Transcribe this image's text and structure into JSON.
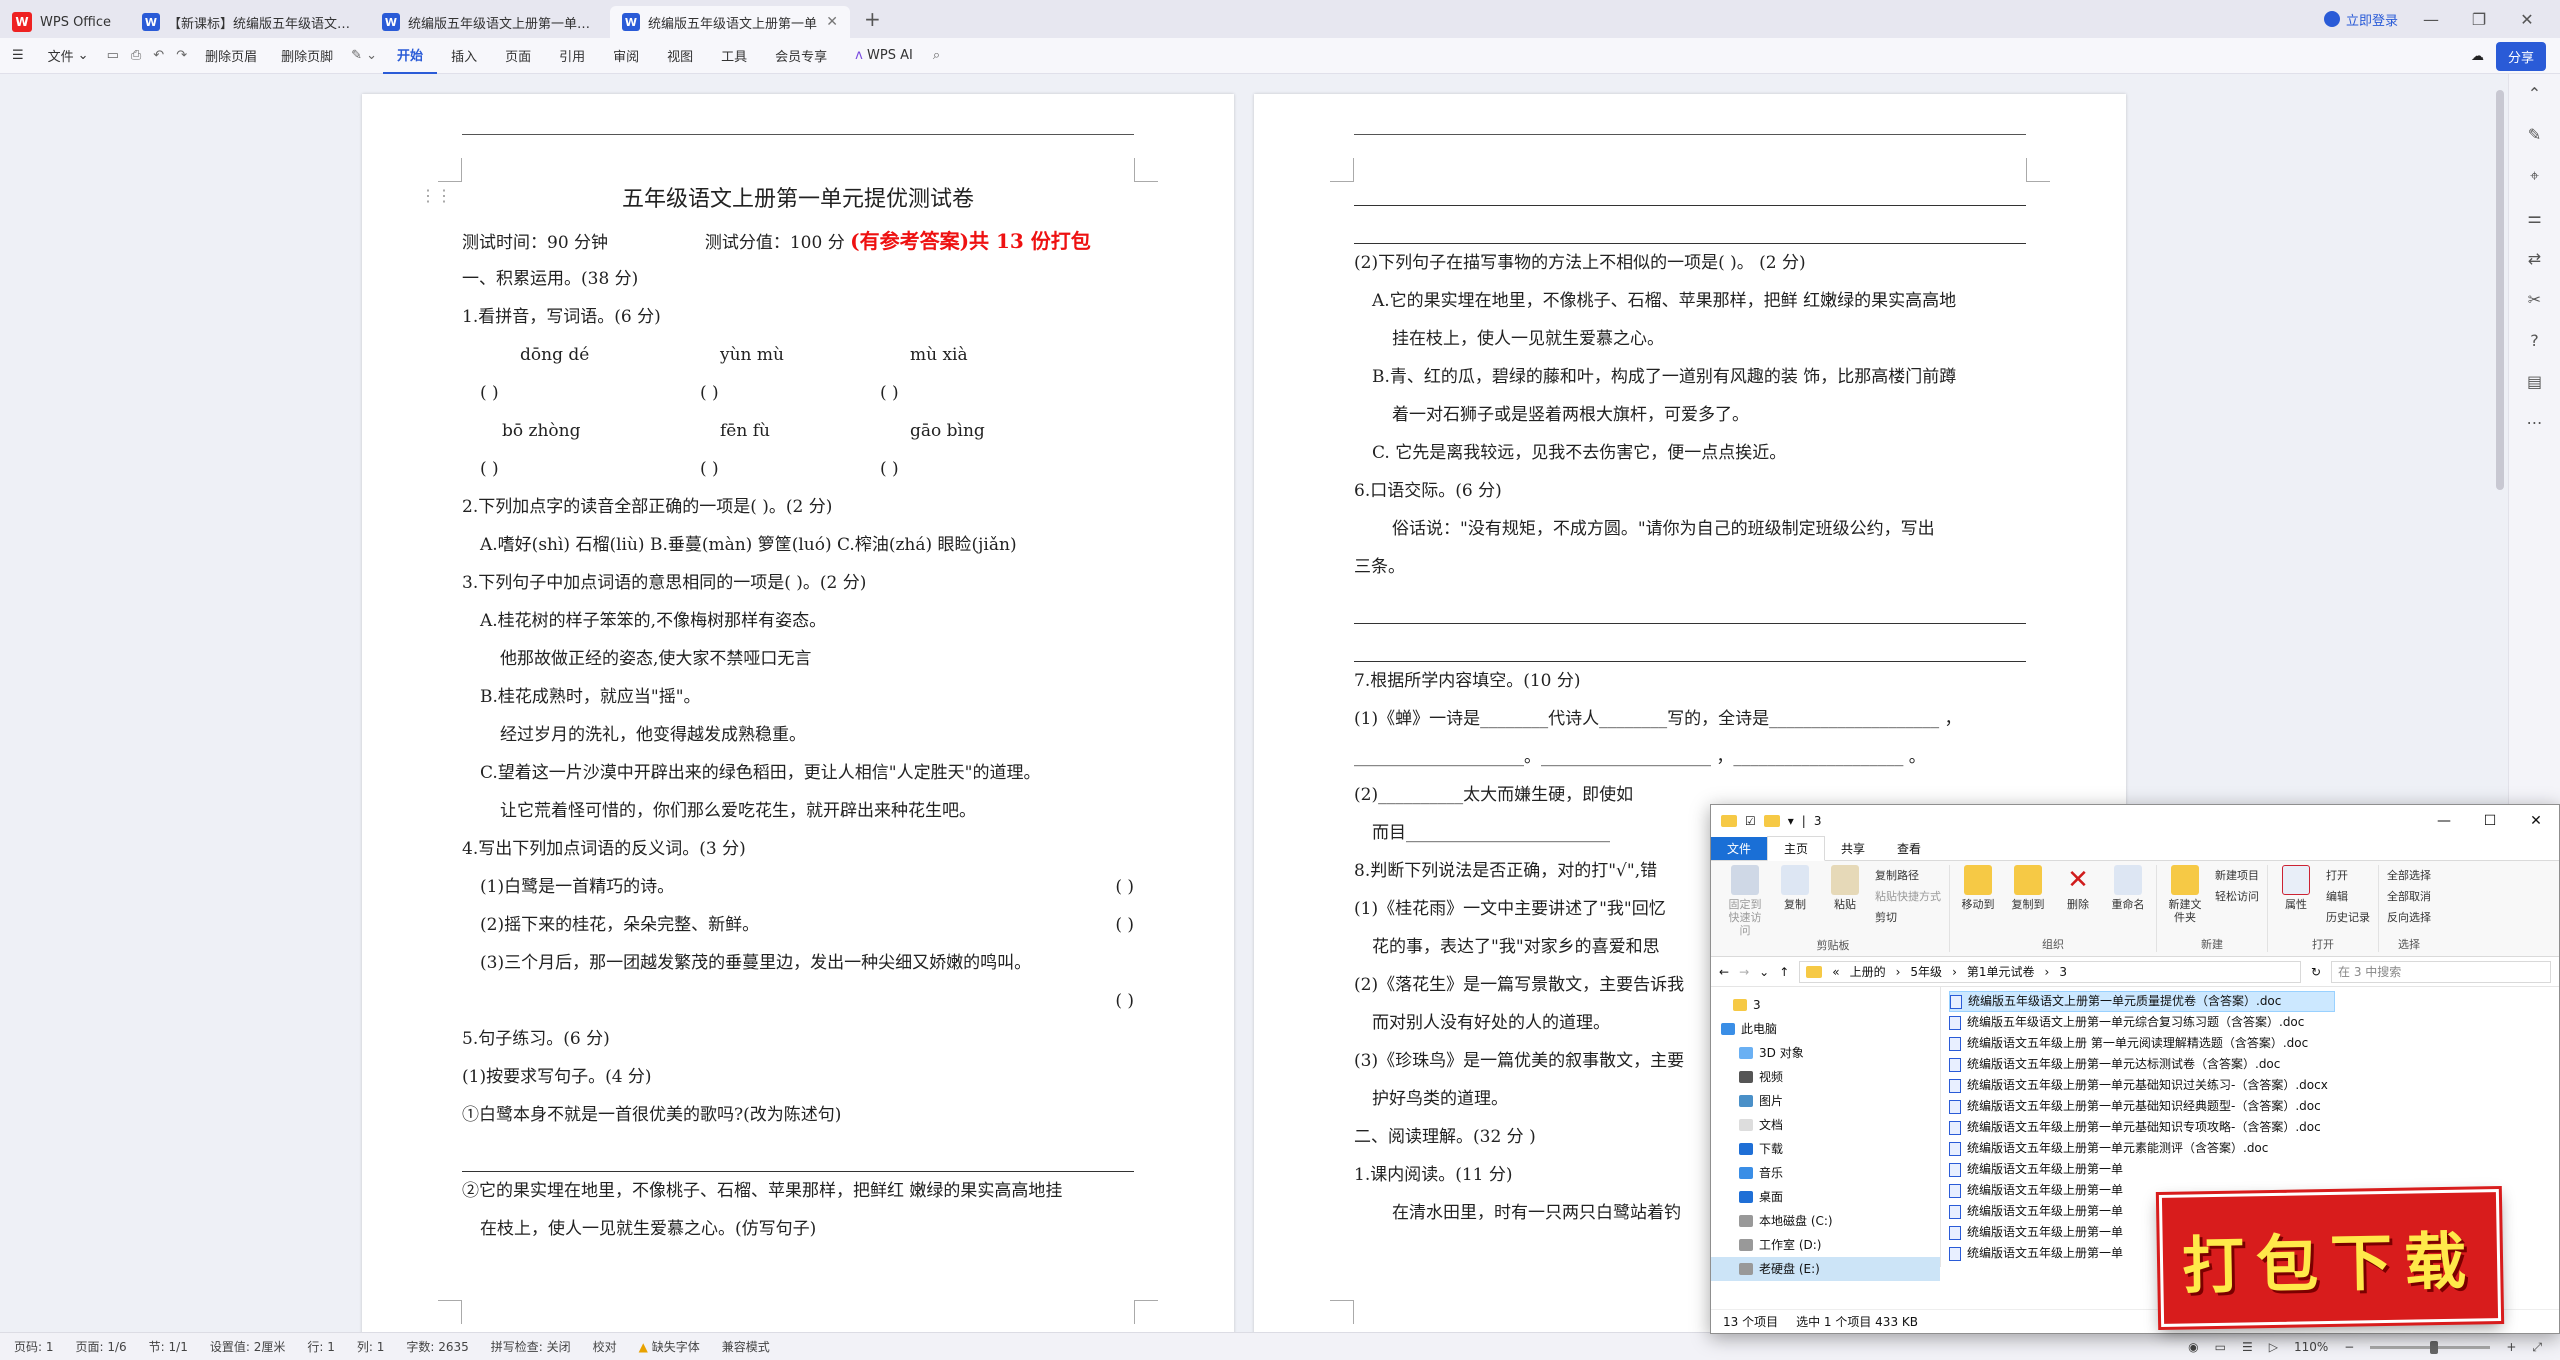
{
  "titlebar": {
    "home_tab": "WPS Office",
    "tabs": [
      "【新课标】统编版五年级语文上册第",
      "统编版五年级语文上册第一单元达标",
      "统编版五年级语文上册第一单"
    ],
    "login": "立即登录"
  },
  "ribbon": {
    "file": "文件",
    "delete_header": "删除页眉",
    "delete_footer": "删除页脚",
    "tabs": [
      "开始",
      "插入",
      "页面",
      "引用",
      "审阅",
      "视图",
      "工具",
      "会员专享"
    ],
    "wps_ai": "WPS AI",
    "share": "分享"
  },
  "left_page": {
    "title": "五年级语文上册第一单元提优测试卷",
    "meta_time": "测试时间：90 分钟",
    "meta_score": "测试分值：100 分",
    "meta_red": "(有参考答案)共 13 份打包",
    "lines": [
      "一、积累运用。(38 分)",
      "1.看拼音，写词语。(6 分)"
    ],
    "pinyin1": [
      "dōng   dé",
      "yùn    mù",
      "mù   xià"
    ],
    "brackets": [
      "(              )",
      "(              )",
      "(              )"
    ],
    "pinyin2": [
      "bō   zhòng",
      "fēn    fù",
      "gāo   bìng"
    ],
    "q2": "2.下列加点字的读音全部正确的一项是(      )。(2 分)",
    "q2_opts": "A.嗜好(shì)   石榴(liù)    B.垂蔓(màn)  箩筐(luó)    C.榨油(zhá)    眼睑(jiǎn)",
    "q3": "3.下列句子中加点词语的意思相同的一项是(      )。(2 分)",
    "q3a1": "A.桂花树的样子笨笨的,不像梅树那样有姿态。",
    "q3a2": "他那故做正经的姿态,使大家不禁哑口无言",
    "q3b1": "B.桂花成熟时，就应当\"摇\"。",
    "q3b2": "经过岁月的洗礼，他变得越发成熟稳重。",
    "q3c1": "C.望着这一片沙漠中开辟出来的绿色稻田，更让人相信\"人定胜天\"的道理。",
    "q3c2": "让它荒着怪可惜的，你们那么爱吃花生，就开辟出来种花生吧。",
    "q4": "4.写出下列加点词语的反义词。(3 分)",
    "q4_1": "(1)白鹭是一首精巧的诗。",
    "q4_2": "(2)摇下来的桂花，朵朵完整、新鲜。",
    "q4_3": "(3)三个月后，那一团越发繁茂的垂蔓里边，发出一种尖细又娇嫩的鸣叫。",
    "paren": "(            )",
    "q5": "5.句子练习。(6 分)",
    "q5_1": "(1)按要求写句子。(4 分)",
    "q5_1a": "①白鹭本身不就是一首很优美的歌吗?(改为陈述句)",
    "q5_1b": "②它的果实埋在地里，不像桃子、石榴、苹果那样，把鲜红 嫩绿的果实高高地挂",
    "q5_1c": "在枝上，使人一见就生爱慕之心。(仿写句子)"
  },
  "right_page": {
    "l1": "(2)下列句子在描写事物的方法上不相似的一项是(      )。 (2 分)",
    "l2": "A.它的果实埋在地里，不像桃子、石榴、苹果那样，把鲜 红嫩绿的果实高高地",
    "l3": "挂在枝上，使人一见就生爱慕之心。",
    "l4": "B.青、红的瓜，碧绿的藤和叶，构成了一道别有风趣的装 饰，比那高楼门前蹲",
    "l5": "着一对石狮子或是竖着两根大旗杆，可爱多了。",
    "l6": "C. 它先是离我较远，见我不去伤害它，便一点点挨近。",
    "l7": "6.口语交际。(6 分)",
    "l8": "俗话说：\"没有规矩，不成方圆。\"请你为自己的班级制定班级公约，写出",
    "l9": "三条。",
    "l10": "7.根据所学内容填空。(10 分)",
    "l11": "(1)《蝉》一诗是________代诗人________写的，全诗是____________________ ，",
    "l12": "____________________。____________________ ，____________________ 。",
    "l13": "(2)__________太大而嫌生硬，即使如",
    "l14": "而目________________________",
    "l15": "8.判断下列说法是否正确，对的打\"√\",错",
    "l16": "(1)《桂花雨》一文中主要讲述了\"我\"回忆",
    "l17": "花的事，表达了\"我\"对家乡的喜爱和思",
    "l18": "(2)《落花生》是一篇写景散文，主要告诉我",
    "l19": "而对别人没有好处的人的道理。",
    "l20": "(3)《珍珠鸟》是一篇优美的叙事散文，主要",
    "l21": "护好鸟类的道理。",
    "l22": "二、阅读理解。(32 分 )",
    "l23": "1.课内阅读。(11 分)",
    "l24": "在清水田里，时有一只两只白鹭站着钓"
  },
  "statusbar": {
    "page_code": "页码: 1",
    "page_count": "页面: 1/6",
    "section": "节: 1/1",
    "setting": "设置值: 2厘米",
    "row": "行: 1",
    "col": "列: 1",
    "words": "字数: 2635",
    "spell": "拼写检查: 关闭",
    "proof": "校对",
    "missing_font": "缺失字体",
    "compat": "兼容模式",
    "zoom": "110%"
  },
  "explorer": {
    "title": "3",
    "tabs": [
      "文件",
      "主页",
      "共享",
      "查看"
    ],
    "ribbon": {
      "pin": "固定到快速访问",
      "copy": "复制",
      "paste": "粘贴",
      "copy_path": "复制路径",
      "paste_shortcut": "粘贴快捷方式",
      "cut": "剪切",
      "clipboard": "剪贴板",
      "move_to": "移动到",
      "copy_to": "复制到",
      "delete": "删除",
      "rename": "重命名",
      "organize": "组织",
      "new_folder": "新建文件夹",
      "new_item": "新建项目",
      "easy_access": "轻松访问",
      "new": "新建",
      "properties": "属性",
      "open": "打开",
      "edit": "编辑",
      "history": "历史记录",
      "open_group": "打开",
      "select_all": "全部选择",
      "select_none": "全部取消",
      "invert": "反向选择",
      "select": "选择"
    },
    "breadcrumb": [
      "上册的",
      "5年级",
      "第1单元试卷",
      "3"
    ],
    "search_placeholder": "在 3 中搜索",
    "nav": [
      "3",
      "此电脑",
      "3D 对象",
      "视频",
      "图片",
      "文档",
      "下载",
      "音乐",
      "桌面",
      "本地磁盘 (C:)",
      "工作室 (D:)",
      "老硬盘 (E:)"
    ],
    "files": [
      "统编版五年级语文上册第一单元质量提优卷（含答案）.doc",
      "统编版五年级语文上册第一单元综合复习练习题（含答案）.doc",
      "统编版语文五年级上册 第一单元阅读理解精选题（含答案）.doc",
      "统编版语文五年级上册第一单元达标测试卷（含答案）.doc",
      "统编版语文五年级上册第一单元基础知识过关练习-（含答案）.docx",
      "统编版语文五年级上册第一单元基础知识经典题型-（含答案）.doc",
      "统编版语文五年级上册第一单元基础知识专项攻略-（含答案）.doc",
      "统编版语文五年级上册第一单元素能测评（含答案）.doc",
      "统编版语文五年级上册第一单",
      "统编版语文五年级上册第一单",
      "统编版语文五年级上册第一单",
      "统编版语文五年级上册第一单",
      "统编版语文五年级上册第一单"
    ],
    "status_count": "13 个项目",
    "status_selected": "选中 1 个项目  433 KB"
  },
  "badge": "打包下载",
  "colors": {
    "accent": "#2a5bd7",
    "red": "#e11111",
    "badge_bg": "#d81c1c",
    "badge_text": "#ffe94a"
  }
}
